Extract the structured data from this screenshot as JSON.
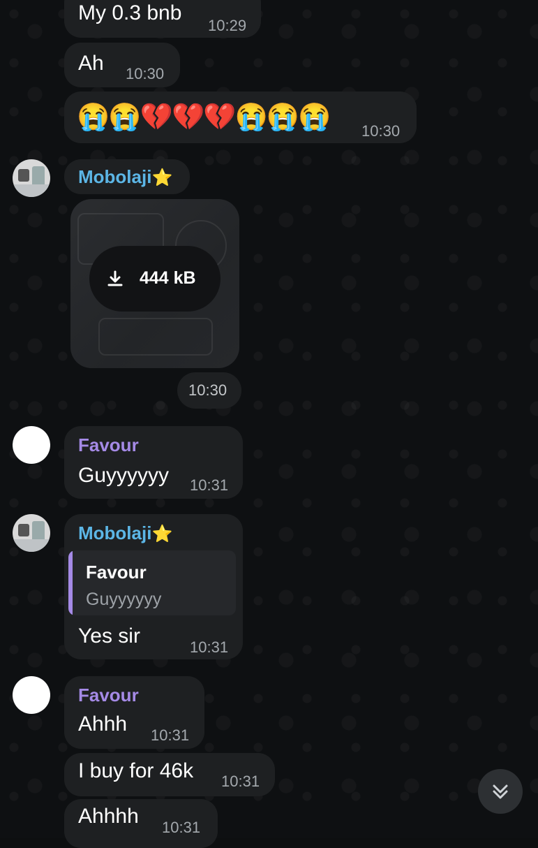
{
  "messages": {
    "m1": {
      "text": "My 0.3 bnb",
      "time": "10:29"
    },
    "m2": {
      "text": "Ah",
      "time": "10:30"
    },
    "m3": {
      "text": "😭😭💔💔💔😭😭😭",
      "time": "10:30"
    },
    "m4": {
      "sender": "Mobolaji",
      "badge": "⭐"
    },
    "m5": {
      "download_size": "444 kB",
      "time": "10:30"
    },
    "m6": {
      "sender": "Favour",
      "text": "Guyyyyyy",
      "time": "10:31"
    },
    "m7": {
      "sender": "Mobolaji",
      "badge": "⭐",
      "reply_to": {
        "sender": "Favour",
        "text": "Guyyyyyy"
      },
      "text": "Yes sir",
      "time": "10:31"
    },
    "m8": {
      "sender": "Favour",
      "text": "Ahhh",
      "time": "10:31"
    },
    "m9": {
      "text": "I buy for 46k",
      "time": "10:31"
    },
    "m10": {
      "text": "Ahhhh",
      "time": "10:31"
    }
  },
  "icons": {
    "download": "download-icon",
    "scroll": "double-chevron-down-icon"
  },
  "colors": {
    "background": "#0e1012",
    "bubble": "#1e2022",
    "sender_blue": "#5cb6e6",
    "sender_purple": "#a58ae6",
    "time": "#a4a9ae"
  }
}
